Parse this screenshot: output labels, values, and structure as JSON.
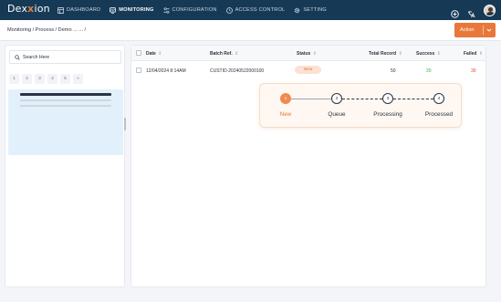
{
  "app": {
    "logo_main": "Dex",
    "logo_x": "x",
    "logo_rest": "ion"
  },
  "nav": {
    "items": [
      {
        "label": "DASHBOARD",
        "icon": "dashboard-icon"
      },
      {
        "label": "MONITORING",
        "icon": "monitor-icon"
      },
      {
        "label": "CONFIGURATION",
        "icon": "sliders-icon"
      },
      {
        "label": "ACCESS CONTROL",
        "icon": "clock-icon"
      },
      {
        "label": "SETTING",
        "icon": "gear-icon"
      }
    ],
    "active": "MONITORING"
  },
  "breadcrumb": "Monitoring / Process / Demo ... ... /",
  "action": {
    "label": "Action"
  },
  "sidebar": {
    "search_placeholder": "Search Here",
    "pages": [
      "1",
      "2",
      "3",
      "4",
      "5",
      "»"
    ]
  },
  "table": {
    "columns": [
      "Date",
      "Batch Ref.",
      "Status",
      "Total Record",
      "Success",
      "Failed"
    ],
    "rows": [
      {
        "date": "12/04/2024 8:14AM",
        "batch_ref": "CUSTID-20240522000100",
        "status": "New",
        "total": "50",
        "success": "20",
        "failed": "30"
      }
    ]
  },
  "progress": {
    "steps": [
      {
        "num": "1",
        "label": "New",
        "active": true
      },
      {
        "num": "2",
        "label": "Queue",
        "active": false
      },
      {
        "num": "3",
        "label": "Processing",
        "active": false
      },
      {
        "num": "4",
        "label": "Processed",
        "active": false
      }
    ]
  },
  "colors": {
    "topbar": "#163a56",
    "accent": "#e8783a",
    "success": "#2fb24b",
    "failed": "#e0402e",
    "skeleton": "#e2f0fc"
  }
}
